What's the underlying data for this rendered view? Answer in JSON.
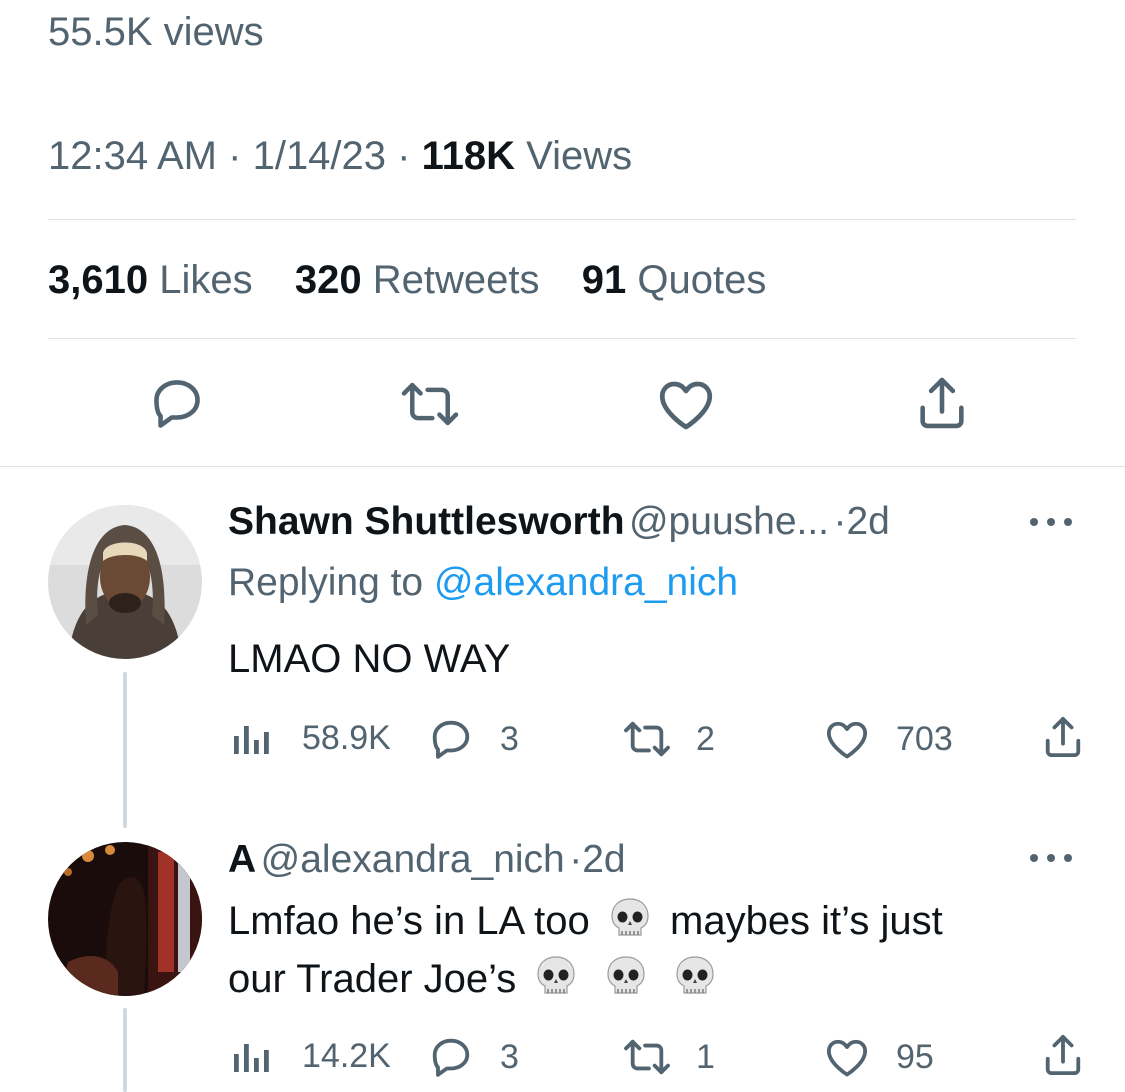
{
  "top": {
    "views_line": "55.5K views",
    "time": "12:34 AM",
    "date": "1/14/23",
    "views_count": "118K",
    "views_label": "Views"
  },
  "stats": {
    "likes_count": "3,610",
    "likes_label": "Likes",
    "retweets_count": "320",
    "retweets_label": "Retweets",
    "quotes_count": "91",
    "quotes_label": "Quotes"
  },
  "replies": [
    {
      "name": "Shawn Shuttlesworth",
      "handle": "@puushe...",
      "sep": "·",
      "age": "2d",
      "replying_prefix": "Replying to",
      "replying_to": "@alexandra_nich",
      "text": "LMAO NO WAY",
      "views": "58.9K",
      "replies": "3",
      "retweets": "2",
      "likes": "703"
    },
    {
      "name": "A",
      "handle": "@alexandra_nich",
      "sep": "·",
      "age": "2d",
      "text_part1": "Lmfao he’s in LA too",
      "text_part2": "maybes it’s just",
      "text_part3": "our Trader Joe’s",
      "views": "14.2K",
      "replies": "3",
      "retweets": "1",
      "likes": "95"
    }
  ],
  "colors": {
    "text": "#0f1419",
    "muted": "#536471",
    "link": "#1d9bf0",
    "divider": "#dfe3e6"
  },
  "icons": [
    "reply-icon",
    "retweet-icon",
    "like-icon",
    "share-icon",
    "views-icon",
    "more-icon",
    "skull-emoji"
  ]
}
